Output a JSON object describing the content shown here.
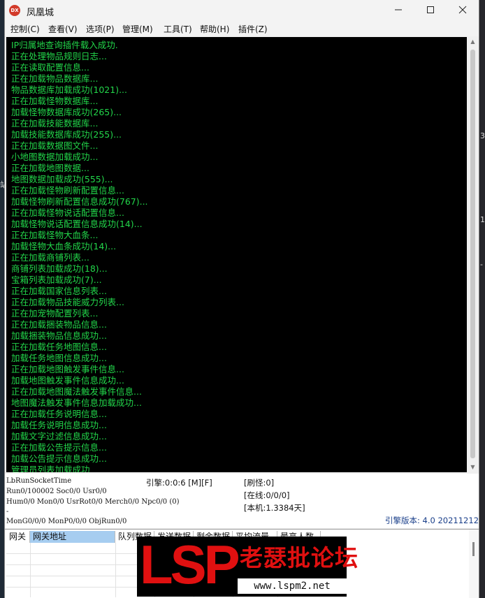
{
  "window": {
    "title": "凤凰城",
    "icon_label": "DX"
  },
  "desktop": {
    "right_marks": [
      "3",
      "1",
      "-"
    ],
    "left_marks": [
      "站"
    ]
  },
  "menu": [
    "控制(C)",
    "查看(V)",
    "选项(P)",
    "管理(M)",
    "工具(T)",
    "帮助(H)",
    "插件(Z)"
  ],
  "log": [
    "IP归属地查询插件载入成功.",
    "正在处理物品规则日志...",
    "正在读取配置信息...",
    "正在加载物品数据库...",
    "物品数据库加载成功(1021)...",
    "正在加载怪物数据库...",
    "加载怪物数据库成功(265)...",
    "正在加载技能数据库...",
    "加载技能数据库成功(255)...",
    "正在加载数据图文件...",
    "小地图数据加载成功...",
    "正在加载地图数据...",
    "地图数据加载成功(555)...",
    "正在加载怪物刷新配置信息...",
    "加载怪物刷新配置信息成功(767)...",
    "正在加载怪物说话配置信息...",
    "加载怪物说话配置信息成功(14)...",
    "正在加载怪物大血条...",
    "加载怪物大血条成功(14)...",
    "正在加载商铺列表...",
    "商铺列表加载成功(18)...",
    "宝箱列表加载成功(7)...",
    "正在加载国家信息列表...",
    "正在加载物品技能威力列表...",
    "正在加宠物配置列表...",
    "正在加载捆装物品信息...",
    "加载捆装物品信息成功...",
    "正在加载任务地图信息...",
    "加载任务地图信息成功...",
    "正在加载地图触发事件信息...",
    "加载地图触发事件信息成功...",
    "正在加载地图魔法触发事件信息...",
    "地图魔法触发事件信息加载成功...",
    "正在加载任务说明信息...",
    "加载任务说明信息成功...",
    "加载文字过滤信息成功...",
    "正在加载公告提示信息...",
    "加载公告提示信息成功...",
    "管理员列表加载成功"
  ],
  "status": {
    "line1": "LbRunSocketTime",
    "line2": "Run0/100002 Soc0/0 Usr0/0",
    "line3": "Hum0/0 Mon0/0 UsrRot0/0 Merch0/0 Npc0/0 (0)",
    "line4": "-",
    "line5": "MonG0/0/0 MonP0/0/0 ObjRun0/0",
    "engine": "引擎:0:0:6 [M][F]",
    "refresh_monster": "[刷怪:0]",
    "online": "[在线:0/0/0]",
    "local": "[本机:1.3384天]",
    "version": "引擎版本: 4.0 20211212"
  },
  "grid": {
    "columns": [
      "网关",
      "网关地址",
      "队列数据",
      "发送数据",
      "剩余数据",
      "平均流量",
      "最高人数"
    ]
  },
  "watermark": {
    "logo": "LSP",
    "title": "老瑟批论坛",
    "url": "www.lspm2.net"
  },
  "colors": {
    "console_bg": "#000000",
    "console_text": "#22d64a",
    "version_text": "#1a3f8a",
    "grid_header_selected": "#a6cdf0",
    "watermark_red": "#e01010"
  }
}
